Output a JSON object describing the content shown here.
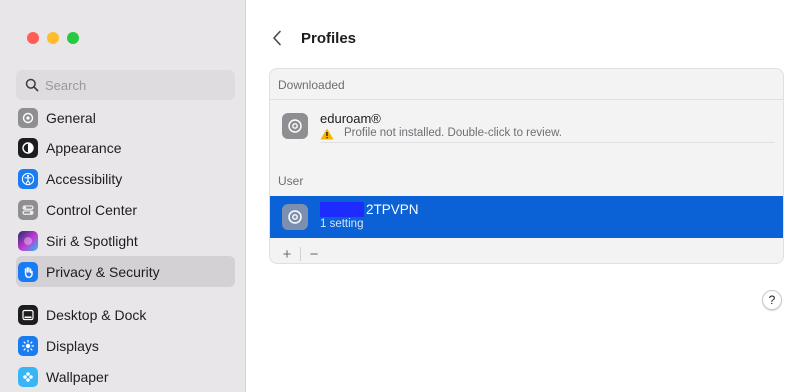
{
  "window": {
    "traffic_lights": [
      "close",
      "minimize",
      "zoom"
    ]
  },
  "sidebar": {
    "search": {
      "placeholder": "Search",
      "value": ""
    },
    "items": [
      {
        "label": "General",
        "icon": "gear-icon",
        "color": "#8e8e93"
      },
      {
        "label": "Appearance",
        "icon": "appearance-icon",
        "color": "#1d1d1f"
      },
      {
        "label": "Accessibility",
        "icon": "accessibility-icon",
        "color": "#1a7cf3"
      },
      {
        "label": "Control Center",
        "icon": "control-center-icon",
        "color": "#8e8e93"
      },
      {
        "label": "Siri & Spotlight",
        "icon": "siri-icon",
        "color": "#5a3fd6"
      },
      {
        "label": "Privacy & Security",
        "icon": "hand-icon",
        "color": "#1a7cf3",
        "selected": true
      },
      {
        "label": "Desktop & Dock",
        "icon": "dock-icon",
        "color": "#1d1d1f"
      },
      {
        "label": "Displays",
        "icon": "displays-icon",
        "color": "#1a7cf3"
      },
      {
        "label": "Wallpaper",
        "icon": "wallpaper-icon",
        "color": "#38b5f5"
      }
    ]
  },
  "main": {
    "title": "Profiles",
    "sections": {
      "downloaded": {
        "label": "Downloaded",
        "profile": {
          "name": "eduroam®",
          "status": "Profile not installed. Double-click to review."
        }
      },
      "user": {
        "label": "User",
        "profile": {
          "name": "2TPVPN",
          "detail": "1 setting",
          "selected": true
        }
      }
    },
    "toolbar": {
      "add_label": "+",
      "remove_label": "−"
    },
    "help_label": "?"
  },
  "colors": {
    "accent": "#0b61d6",
    "sidebar_bg": "#e8e6e8",
    "warning": "#f5b400"
  }
}
